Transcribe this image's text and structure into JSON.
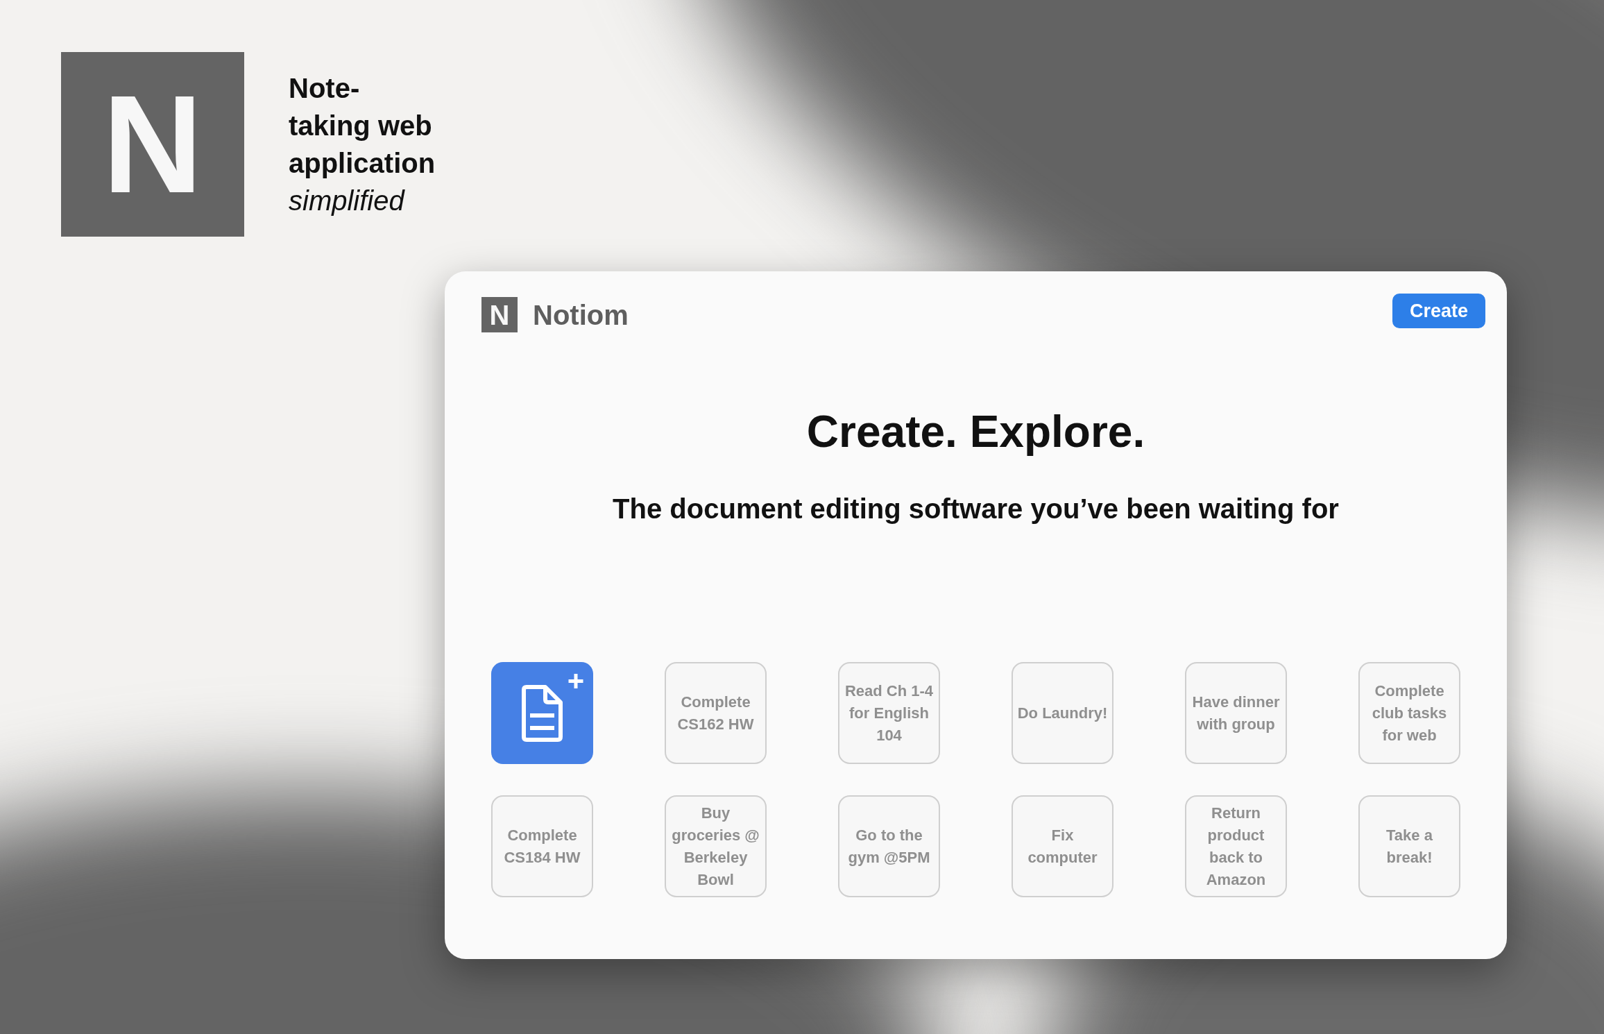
{
  "brand": {
    "logo_letter": "N",
    "tagline": "Note-taking web application *simplified*"
  },
  "window": {
    "logo_letter": "N",
    "app_name": "Notiom",
    "create_button": "Create",
    "heading": "Create. Explore.",
    "subheading": "The document editing software you’ve been waiting for"
  },
  "tiles": [
    {
      "kind": "new"
    },
    {
      "kind": "note",
      "label": "Complete CS162 HW"
    },
    {
      "kind": "note",
      "label": "Read Ch 1-4 for English 104"
    },
    {
      "kind": "note",
      "label": "Do Laundry!"
    },
    {
      "kind": "note",
      "label": "Have dinner with group"
    },
    {
      "kind": "note",
      "label": "Complete club tasks for web"
    },
    {
      "kind": "note",
      "label": "Complete CS184 HW"
    },
    {
      "kind": "note",
      "label": "Buy groceries @ Berkeley Bowl"
    },
    {
      "kind": "note",
      "label": "Go to the gym @5PM"
    },
    {
      "kind": "note",
      "label": "Fix computer"
    },
    {
      "kind": "note",
      "label": "Return product back to Amazon"
    },
    {
      "kind": "note",
      "label": "Take a break!"
    }
  ]
}
